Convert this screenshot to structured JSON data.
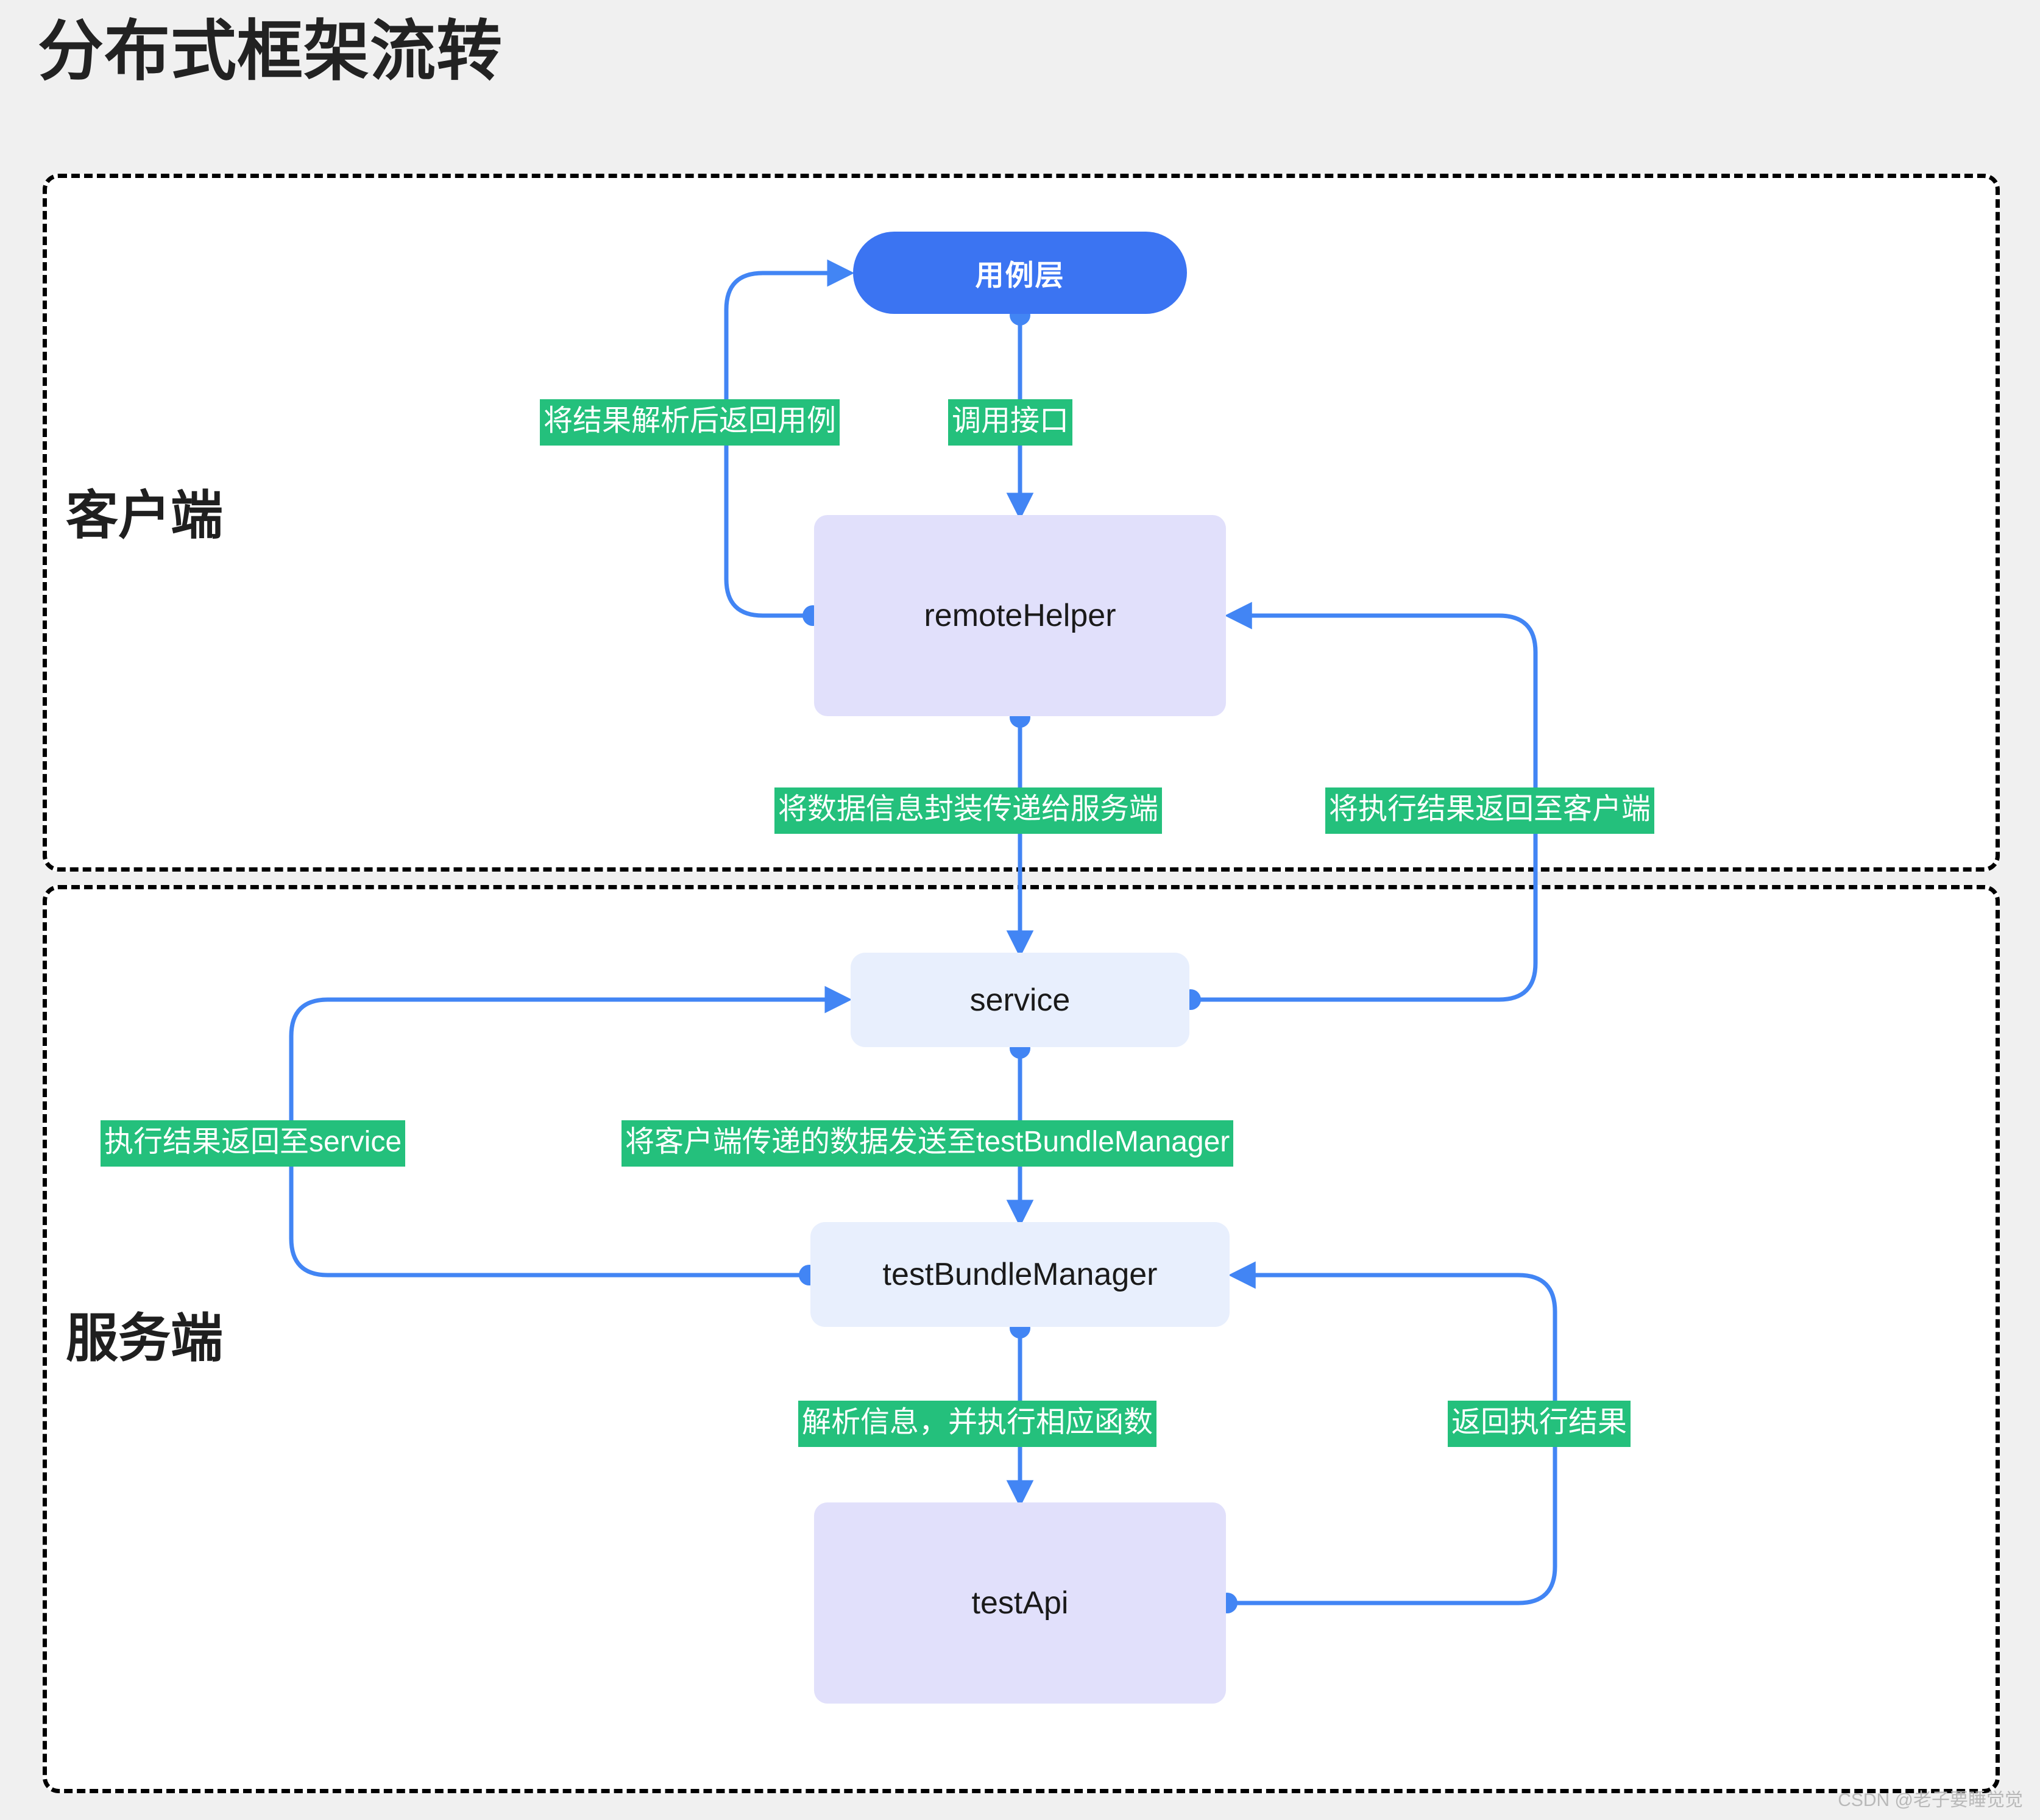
{
  "page": {
    "title": "分布式框架流转",
    "background_color": "#f0f0f0",
    "watermark": "CSDN @老子要睡觉觉"
  },
  "zones": [
    {
      "id": "client",
      "label": "客户端"
    },
    {
      "id": "server",
      "label": "服务端"
    }
  ],
  "nodes": [
    {
      "id": "usecase",
      "label": "用例层",
      "zone": "client",
      "fill": "#3b74f2",
      "text_color": "#ffffff",
      "shape": "stadium"
    },
    {
      "id": "remoteHelper",
      "label": "remoteHelper",
      "zone": "client",
      "fill": "#e1e0fb",
      "text_color": "#1a1a1a",
      "shape": "rounded-rect"
    },
    {
      "id": "service",
      "label": "service",
      "zone": "server",
      "fill": "#e8effd",
      "text_color": "#1a1a1a",
      "shape": "rounded-rect"
    },
    {
      "id": "testBundleManager",
      "label": "testBundleManager",
      "zone": "server",
      "fill": "#e8effd",
      "text_color": "#1a1a1a",
      "shape": "rounded-rect"
    },
    {
      "id": "testApi",
      "label": "testApi",
      "zone": "server",
      "fill": "#e1e0fb",
      "text_color": "#1a1a1a",
      "shape": "rounded-rect"
    }
  ],
  "edges": [
    {
      "id": "e1",
      "from": "usecase",
      "to": "remoteHelper",
      "label": "调用接口"
    },
    {
      "id": "e2",
      "from": "remoteHelper",
      "to": "usecase",
      "label": "将结果解析后返回用例"
    },
    {
      "id": "e3",
      "from": "remoteHelper",
      "to": "service",
      "label": "将数据信息封装传递给服务端"
    },
    {
      "id": "e4",
      "from": "service",
      "to": "remoteHelper",
      "label": "将执行结果返回至客户端"
    },
    {
      "id": "e5",
      "from": "service",
      "to": "testBundleManager",
      "label": "将客户端传递的数据发送至testBundleManager"
    },
    {
      "id": "e6",
      "from": "testBundleManager",
      "to": "service",
      "label": "执行结果返回至service"
    },
    {
      "id": "e7",
      "from": "testBundleManager",
      "to": "testApi",
      "label": "解析信息，并执行相应函数"
    },
    {
      "id": "e8",
      "from": "testApi",
      "to": "testBundleManager",
      "label": "返回执行结果"
    }
  ],
  "colors": {
    "edge": "#4285f4",
    "edge_label_bg": "#24c07c",
    "edge_label_text": "#ffffff",
    "zone_border": "#000000",
    "zone_fill": "#ffffff"
  }
}
